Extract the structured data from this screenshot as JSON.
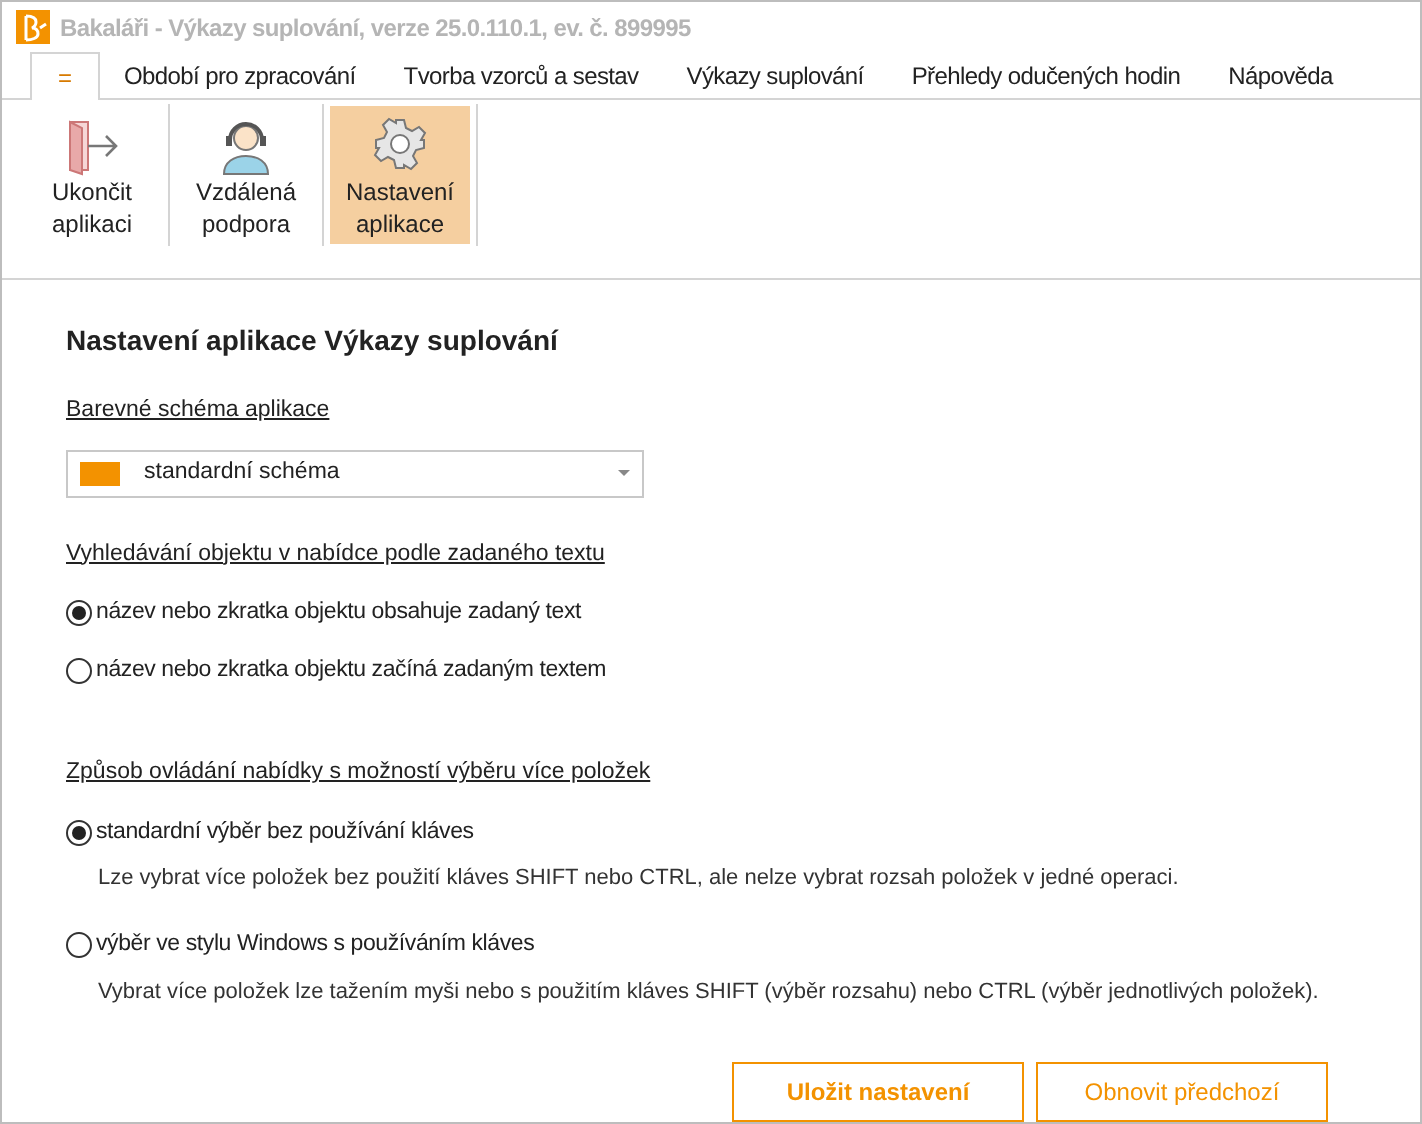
{
  "window": {
    "title": "Bakaláři - Výkazy suplování, verze 25.0.110.1, ev. č. 899995"
  },
  "tabs": [
    {
      "label": "=",
      "selected": true
    },
    {
      "label": "Období pro zpracování",
      "selected": false
    },
    {
      "label": "Tvorba vzorců a sestav",
      "selected": false
    },
    {
      "label": "Výkazy suplování",
      "selected": false
    },
    {
      "label": "Přehledy odučených hodin",
      "selected": false
    },
    {
      "label": "Nápověda",
      "selected": false
    }
  ],
  "ribbon": [
    {
      "kind": "exit",
      "label": "Ukončit aplikaci",
      "selected": false
    },
    {
      "kind": "support",
      "label": "Vzdálená podpora",
      "selected": false
    },
    {
      "kind": "settings",
      "label": "Nastavení aplikace",
      "selected": true
    }
  ],
  "settings": {
    "title": "Nastavení aplikace Výkazy suplování",
    "scheme": {
      "label": "Barevné schéma aplikace",
      "value": "standardní schéma",
      "color": "#f39200"
    },
    "search": {
      "label": "Vyhledávání objektu v nabídce podle zadaného textu",
      "options": [
        {
          "label": "název nebo zkratka objektu obsahuje zadaný text",
          "selected": true
        },
        {
          "label": "název nebo zkratka objektu začíná zadaným textem",
          "selected": false
        }
      ]
    },
    "multi": {
      "label": "Způsob ovládání nabídky s možností výběru více položek",
      "options": [
        {
          "label": "standardní výběr bez používání kláves",
          "description": "Lze vybrat více položek bez použití kláves SHIFT nebo CTRL, ale nelze vybrat rozsah položek v jedné operaci.",
          "selected": true
        },
        {
          "label": "výběr ve stylu Windows s používáním kláves",
          "description": "Vybrat více položek lze tažením myši nebo s použitím kláves SHIFT (výběr rozsahu) nebo CTRL (výběr jednotlivých položek).",
          "selected": false
        }
      ]
    },
    "buttons": [
      {
        "label": "Uložit nastavení",
        "kind": "primary"
      },
      {
        "label": "Obnovit předchozí",
        "kind": "secondary"
      }
    ]
  }
}
